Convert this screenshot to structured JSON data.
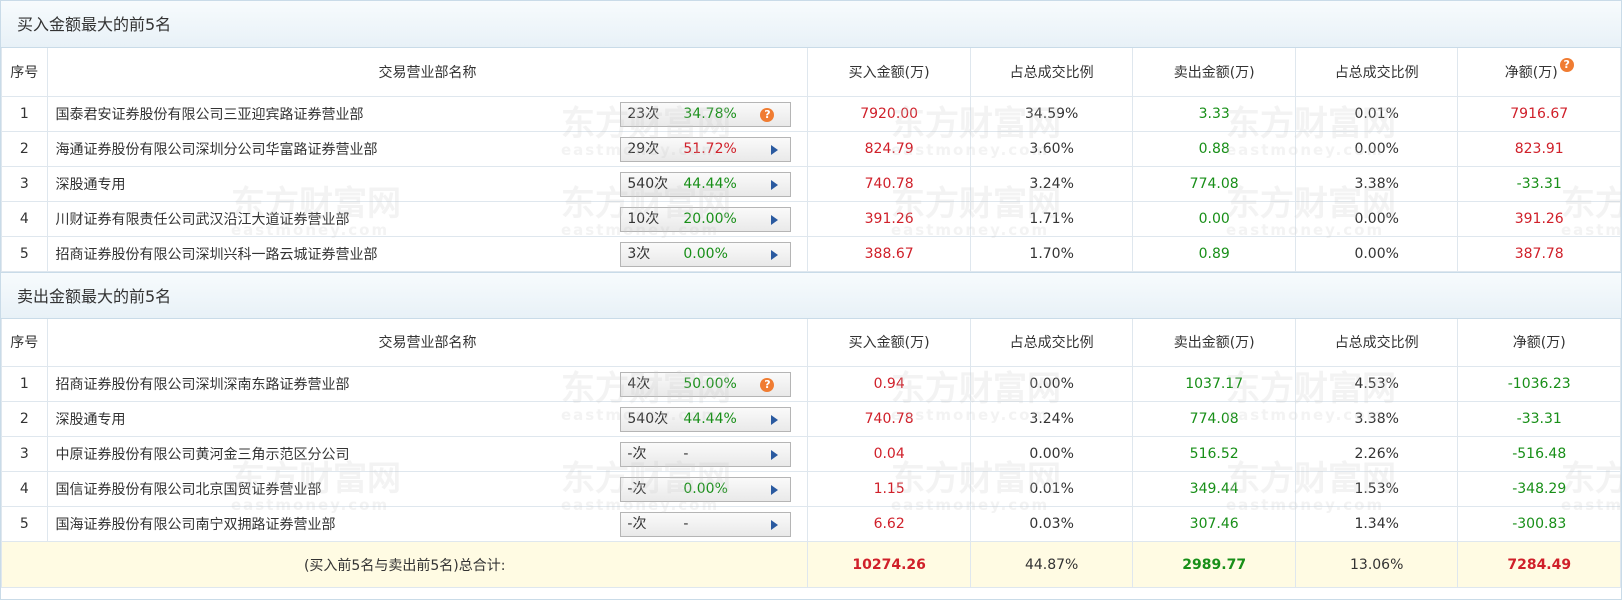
{
  "buy_section": {
    "title": "买入金额最大的前5名",
    "headers": [
      "序号",
      "交易营业部名称",
      "买入金额(万)",
      "占总成交比例",
      "卖出金额(万)",
      "占总成交比例",
      "净额(万)"
    ],
    "rows": [
      {
        "idx": "1",
        "name": "国泰君安证券股份有限公司三亚迎宾路证券营业部",
        "count": "23次",
        "pct": "34.78%",
        "buy": "7920.00",
        "buy_ratio": "34.59%",
        "sell": "3.33",
        "sell_ratio": "0.01%",
        "net": "7916.67"
      },
      {
        "idx": "2",
        "name": "海通证券股份有限公司深圳分公司华富路证券营业部",
        "count": "29次",
        "pct": "51.72%",
        "buy": "824.79",
        "buy_ratio": "3.60%",
        "sell": "0.88",
        "sell_ratio": "0.00%",
        "net": "823.91"
      },
      {
        "idx": "3",
        "name": "深股通专用",
        "count": "540次",
        "pct": "44.44%",
        "buy": "740.78",
        "buy_ratio": "3.24%",
        "sell": "774.08",
        "sell_ratio": "3.38%",
        "net": "-33.31"
      },
      {
        "idx": "4",
        "name": "川财证券有限责任公司武汉沿江大道证券营业部",
        "count": "10次",
        "pct": "20.00%",
        "buy": "391.26",
        "buy_ratio": "1.71%",
        "sell": "0.00",
        "sell_ratio": "0.00%",
        "net": "391.26"
      },
      {
        "idx": "5",
        "name": "招商证券股份有限公司深圳兴科一路云城证券营业部",
        "count": "3次",
        "pct": "0.00%",
        "buy": "388.67",
        "buy_ratio": "1.70%",
        "sell": "0.89",
        "sell_ratio": "0.00%",
        "net": "387.78"
      }
    ]
  },
  "sell_section": {
    "title": "卖出金额最大的前5名",
    "headers": [
      "序号",
      "交易营业部名称",
      "买入金额(万)",
      "占总成交比例",
      "卖出金额(万)",
      "占总成交比例",
      "净额(万)"
    ],
    "rows": [
      {
        "idx": "1",
        "name": "招商证券股份有限公司深圳深南东路证券营业部",
        "count": "4次",
        "pct": "50.00%",
        "buy": "0.94",
        "buy_ratio": "0.00%",
        "sell": "1037.17",
        "sell_ratio": "4.53%",
        "net": "-1036.23"
      },
      {
        "idx": "2",
        "name": "深股通专用",
        "count": "540次",
        "pct": "44.44%",
        "buy": "740.78",
        "buy_ratio": "3.24%",
        "sell": "774.08",
        "sell_ratio": "3.38%",
        "net": "-33.31"
      },
      {
        "idx": "3",
        "name": "中原证券股份有限公司黄河金三角示范区分公司",
        "count": "-次",
        "pct": "-",
        "buy": "0.04",
        "buy_ratio": "0.00%",
        "sell": "516.52",
        "sell_ratio": "2.26%",
        "net": "-516.48"
      },
      {
        "idx": "4",
        "name": "国信证券股份有限公司北京国贸证券营业部",
        "count": "-次",
        "pct": "0.00%",
        "buy": "1.15",
        "buy_ratio": "0.01%",
        "sell": "349.44",
        "sell_ratio": "1.53%",
        "net": "-348.29"
      },
      {
        "idx": "5",
        "name": "国海证券股份有限公司南宁双拥路证券营业部",
        "count": "-次",
        "pct": "-",
        "buy": "6.62",
        "buy_ratio": "0.03%",
        "sell": "307.46",
        "sell_ratio": "1.34%",
        "net": "-300.83"
      }
    ]
  },
  "total": {
    "label": "(买入前5名与卖出前5名)总合计:",
    "buy": "10274.26",
    "buy_ratio": "44.87%",
    "sell": "2989.77",
    "sell_ratio": "13.06%",
    "net": "7284.49"
  },
  "icons": {
    "help": "?"
  },
  "watermark": {
    "text": "东方财富网",
    "sub": "eastmoney.com"
  },
  "colors": {
    "red": "#d0202a",
    "green": "#188f18",
    "accent": "#2a5aa0",
    "help": "#f07c32"
  }
}
